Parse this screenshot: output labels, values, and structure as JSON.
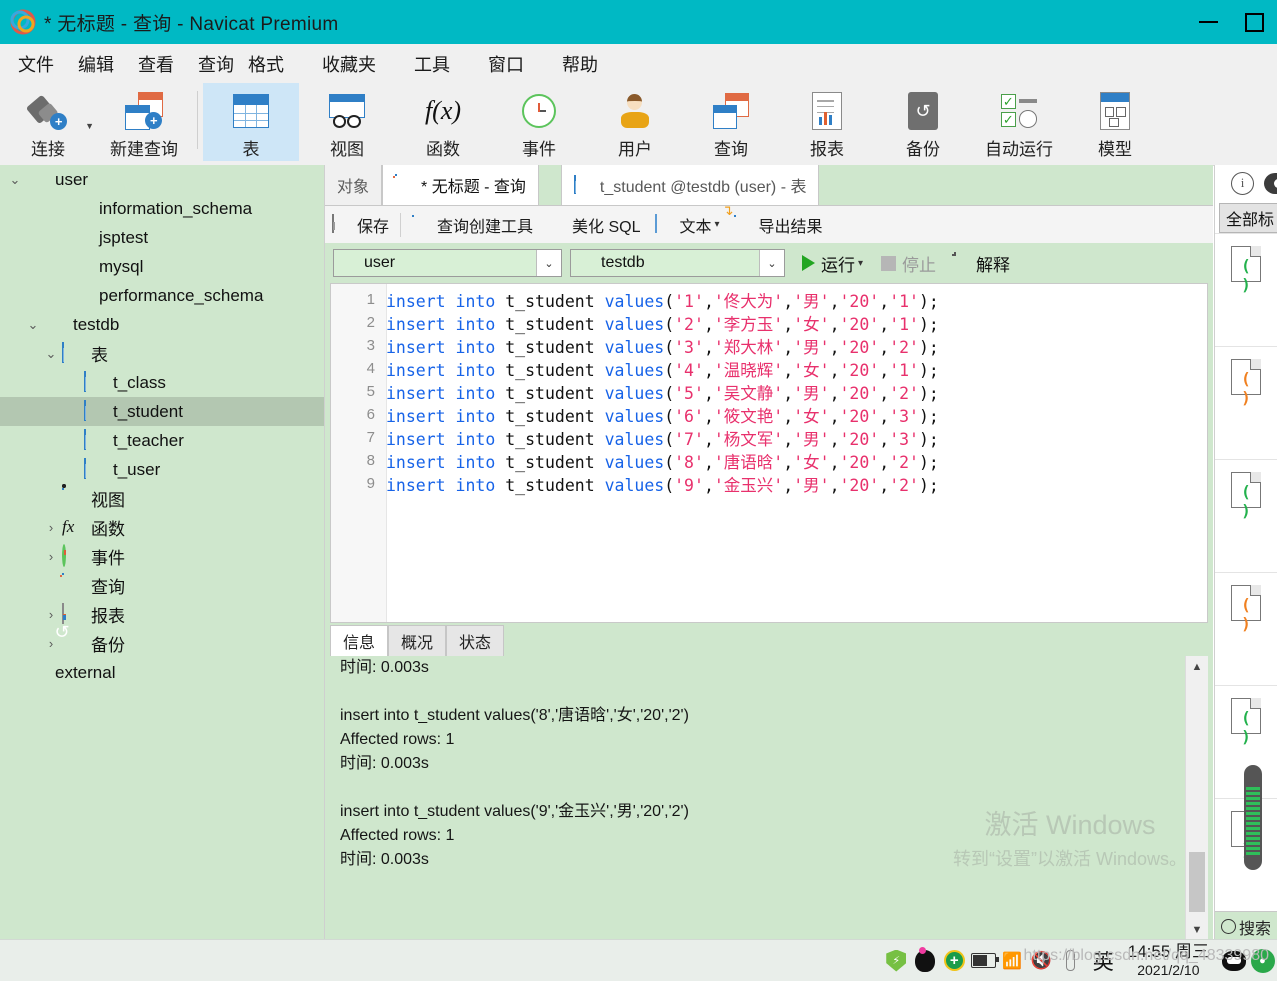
{
  "window": {
    "title": "* 无标题 - 查询 - Navicat Premium",
    "logo_icon": "navicat-logo-icon",
    "minimize_label": "—",
    "maximize_label": "□"
  },
  "menubar": {
    "items": [
      {
        "label": "文件"
      },
      {
        "label": "编辑"
      },
      {
        "label": "查看"
      },
      {
        "label": "查询"
      },
      {
        "label": "格式"
      },
      {
        "label": "收藏夹"
      },
      {
        "label": "工具"
      },
      {
        "label": "窗口"
      },
      {
        "label": "帮助"
      }
    ]
  },
  "toolbar": {
    "items": [
      {
        "label": "连接",
        "icon": "connection-icon",
        "active": false,
        "has_caret": true
      },
      {
        "label": "新建查询",
        "icon": "new-query-icon",
        "active": false,
        "has_caret": false
      },
      {
        "label": "表",
        "icon": "table-icon",
        "active": true,
        "has_caret": false
      },
      {
        "label": "视图",
        "icon": "view-icon",
        "active": false,
        "has_caret": false
      },
      {
        "label": "函数",
        "icon": "function-icon",
        "active": false,
        "has_caret": false
      },
      {
        "label": "事件",
        "icon": "event-clock-icon",
        "active": false,
        "has_caret": false
      },
      {
        "label": "用户",
        "icon": "user-icon",
        "active": false,
        "has_caret": false
      },
      {
        "label": "查询",
        "icon": "query-icon",
        "active": false,
        "has_caret": false
      },
      {
        "label": "报表",
        "icon": "report-icon",
        "active": false,
        "has_caret": false
      },
      {
        "label": "备份",
        "icon": "backup-icon",
        "active": false,
        "has_caret": false
      },
      {
        "label": "自动运行",
        "icon": "automation-icon",
        "active": false,
        "has_caret": false
      },
      {
        "label": "模型",
        "icon": "model-icon",
        "active": false,
        "has_caret": false
      }
    ]
  },
  "sidebar": {
    "items": [
      {
        "label": "user",
        "icon": "navicat-connection-icon",
        "indent": 0,
        "twisty": "expanded",
        "selected": false
      },
      {
        "label": "information_schema",
        "icon": "database-icon",
        "indent": 1,
        "twisty": "none",
        "selected": false
      },
      {
        "label": "jsptest",
        "icon": "database-icon",
        "indent": 1,
        "twisty": "none",
        "selected": false
      },
      {
        "label": "mysql",
        "icon": "database-icon",
        "indent": 1,
        "twisty": "none",
        "selected": false
      },
      {
        "label": "performance_schema",
        "icon": "database-icon",
        "indent": 1,
        "twisty": "none",
        "selected": false
      },
      {
        "label": "testdb",
        "icon": "database-green-icon",
        "indent": 1,
        "twisty": "expanded",
        "selected": false
      },
      {
        "label": "表",
        "icon": "table-icon",
        "indent": 2,
        "twisty": "expanded",
        "selected": false
      },
      {
        "label": "t_class",
        "icon": "table-icon",
        "indent": 3,
        "twisty": "none",
        "selected": false
      },
      {
        "label": "t_student",
        "icon": "table-icon",
        "indent": 3,
        "twisty": "none",
        "selected": true
      },
      {
        "label": "t_teacher",
        "icon": "table-icon",
        "indent": 3,
        "twisty": "none",
        "selected": false
      },
      {
        "label": "t_user",
        "icon": "table-icon",
        "indent": 3,
        "twisty": "none",
        "selected": false
      },
      {
        "label": "视图",
        "icon": "view-icon",
        "indent": 2,
        "twisty": "none",
        "selected": false
      },
      {
        "label": "函数",
        "icon": "function-icon",
        "indent": 2,
        "twisty": "collapsed",
        "selected": false
      },
      {
        "label": "事件",
        "icon": "event-clock-icon",
        "indent": 2,
        "twisty": "collapsed",
        "selected": false
      },
      {
        "label": "查询",
        "icon": "query-icon",
        "indent": 2,
        "twisty": "none",
        "selected": false
      },
      {
        "label": "报表",
        "icon": "report-icon",
        "indent": 2,
        "twisty": "collapsed",
        "selected": false
      },
      {
        "label": "备份",
        "icon": "backup-icon",
        "indent": 2,
        "twisty": "collapsed",
        "selected": false
      },
      {
        "label": "external",
        "icon": "feather-icon",
        "indent": 0,
        "twisty": "none",
        "selected": false
      }
    ]
  },
  "tabs": [
    {
      "label": "对象",
      "icon": "none",
      "state": "inactive-obj"
    },
    {
      "label": "* 无标题 - 查询",
      "icon": "query-icon",
      "state": "active"
    },
    {
      "label": "t_student @testdb (user) - 表",
      "icon": "table-icon",
      "state": "plain"
    }
  ],
  "query_toolbar": {
    "buttons": [
      {
        "label": "保存",
        "icon": "save-icon",
        "caret": false
      },
      {
        "label": "查询创建工具",
        "icon": "builder-icon",
        "caret": false
      },
      {
        "label": "美化 SQL",
        "icon": "beautify-icon",
        "caret": false
      },
      {
        "label": "文本",
        "icon": "text-icon",
        "caret": true
      },
      {
        "label": "导出结果",
        "icon": "export-icon",
        "caret": false
      }
    ]
  },
  "connection_row": {
    "connection": {
      "value": "user",
      "icon": "navicat-connection-icon"
    },
    "database": {
      "value": "testdb",
      "icon": "database-green-icon"
    },
    "run_label": "运行",
    "run_caret": "·",
    "stop_label": "停止",
    "explain_label": "解释"
  },
  "editor": {
    "lines": [
      {
        "num": "1",
        "kw1": "insert",
        "kw2": "into",
        "table": "t_student",
        "fn": "values",
        "args": [
          "'1'",
          "'佟大为'",
          "'男'",
          "'20'",
          "'1'"
        ]
      },
      {
        "num": "2",
        "kw1": "insert",
        "kw2": "into",
        "table": "t_student",
        "fn": "values",
        "args": [
          "'2'",
          "'李方玉'",
          "'女'",
          "'20'",
          "'1'"
        ]
      },
      {
        "num": "3",
        "kw1": "insert",
        "kw2": "into",
        "table": "t_student",
        "fn": "values",
        "args": [
          "'3'",
          "'郑大林'",
          "'男'",
          "'20'",
          "'2'"
        ]
      },
      {
        "num": "4",
        "kw1": "insert",
        "kw2": "into",
        "table": "t_student",
        "fn": "values",
        "args": [
          "'4'",
          "'温晓辉'",
          "'女'",
          "'20'",
          "'1'"
        ]
      },
      {
        "num": "5",
        "kw1": "insert",
        "kw2": "into",
        "table": "t_student",
        "fn": "values",
        "args": [
          "'5'",
          "'吴文静'",
          "'男'",
          "'20'",
          "'2'"
        ]
      },
      {
        "num": "6",
        "kw1": "insert",
        "kw2": "into",
        "table": "t_student",
        "fn": "values",
        "args": [
          "'6'",
          "'筱文艳'",
          "'女'",
          "'20'",
          "'3'"
        ]
      },
      {
        "num": "7",
        "kw1": "insert",
        "kw2": "into",
        "table": "t_student",
        "fn": "values",
        "args": [
          "'7'",
          "'杨文军'",
          "'男'",
          "'20'",
          "'3'"
        ]
      },
      {
        "num": "8",
        "kw1": "insert",
        "kw2": "into",
        "table": "t_student",
        "fn": "values",
        "args": [
          "'8'",
          "'唐语晗'",
          "'女'",
          "'20'",
          "'2'"
        ]
      },
      {
        "num": "9",
        "kw1": "insert",
        "kw2": "into",
        "table": "t_student",
        "fn": "values",
        "args": [
          "'9'",
          "'金玉兴'",
          "'男'",
          "'20'",
          "'2'"
        ]
      }
    ]
  },
  "results": {
    "tabs": [
      {
        "label": "信息",
        "active": true
      },
      {
        "label": "概况",
        "active": false
      },
      {
        "label": "状态",
        "active": false
      }
    ],
    "lines": [
      "时间: 0.003s",
      "",
      "insert into t_student values('8','唐语晗','女','20','2')",
      "Affected rows: 1",
      "时间: 0.003s",
      "",
      "insert into t_student values('9','金玉兴','男','20','2')",
      "Affected rows: 1",
      "时间: 0.003s"
    ]
  },
  "watermark": {
    "line1": "激活 Windows",
    "line2": "转到“设置”以激活 Windows。"
  },
  "right_panel": {
    "info_icon": "info-circle-icon",
    "eye_icon": "eye-icon",
    "all_label": "全部标",
    "entries": [
      {
        "icon": "code-file-green-icon"
      },
      {
        "icon": "code-file-color-icon"
      },
      {
        "icon": "code-file-green-icon"
      },
      {
        "icon": "code-file-color-icon"
      },
      {
        "icon": "code-file-green-icon"
      },
      {
        "icon": "code-file-green-icon"
      }
    ],
    "search_label": "搜索"
  },
  "taskbar": {
    "tray_icons": [
      {
        "name": "security-shield-icon"
      },
      {
        "name": "qq-penguin-icon"
      },
      {
        "name": "plus-circle-icon"
      },
      {
        "name": "battery-icon"
      },
      {
        "name": "wifi-icon"
      },
      {
        "name": "volume-muted-icon"
      },
      {
        "name": "thermometer-icon"
      }
    ],
    "ime_label": "英",
    "clock_time": "14:55 周三",
    "clock_date": "2021/2/10",
    "url_watermark": "https://blog.csdn.net/qq_48339980"
  },
  "colors": {
    "titlebar": "#00b9c4",
    "sidebar_bg": "#cfe7cd",
    "selected_row": "#b3c7b1",
    "toolbar_active": "#cee6f7",
    "keyword": "#1763e8",
    "string": "#e8306c",
    "run_green": "#22a522"
  }
}
